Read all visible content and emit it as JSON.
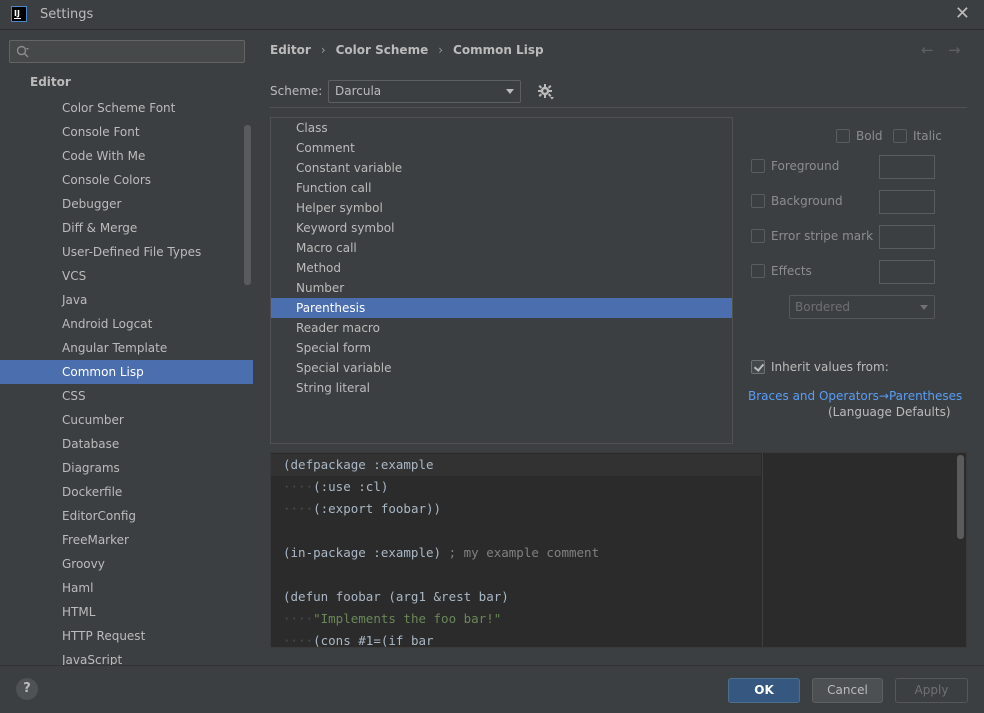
{
  "window": {
    "title": "Settings",
    "app_icon_text": "IJ"
  },
  "sidebar": {
    "search_value": "",
    "header": "Editor",
    "items": [
      "Color Scheme Font",
      "Console Font",
      "Code With Me",
      "Console Colors",
      "Debugger",
      "Diff & Merge",
      "User-Defined File Types",
      "VCS",
      "Java",
      "Android Logcat",
      "Angular Template",
      "Common Lisp",
      "CSS",
      "Cucumber",
      "Database",
      "Diagrams",
      "Dockerfile",
      "EditorConfig",
      "FreeMarker",
      "Groovy",
      "Haml",
      "HTML",
      "HTTP Request",
      "JavaScript"
    ],
    "selected_item": "Common Lisp"
  },
  "breadcrumb": [
    "Editor",
    "Color Scheme",
    "Common Lisp"
  ],
  "scheme": {
    "label": "Scheme:",
    "value": "Darcula"
  },
  "tokens": {
    "items": [
      "Class",
      "Comment",
      "Constant variable",
      "Function call",
      "Helper symbol",
      "Keyword symbol",
      "Macro call",
      "Method",
      "Number",
      "Parenthesis",
      "Reader macro",
      "Special form",
      "Special variable",
      "String literal"
    ],
    "selected": "Parenthesis"
  },
  "options": {
    "bold": "Bold",
    "italic": "Italic",
    "foreground": "Foreground",
    "background": "Background",
    "error_stripe": "Error stripe mark",
    "effects": "Effects",
    "effect_type": "Bordered",
    "inherit_label": "Inherit values from:",
    "inherit_checked": true,
    "inherit_link": "Braces and Operators→Parentheses",
    "inherit_sub": "(Language Defaults)"
  },
  "preview": {
    "lines": [
      {
        "indent": "",
        "code": "(defpackage :example",
        "comment": "",
        "str": "",
        "rest": ""
      },
      {
        "indent": "····",
        "code": "(:use :cl)",
        "comment": "",
        "str": "",
        "rest": ""
      },
      {
        "indent": "····",
        "code": "(:export foobar))",
        "comment": "",
        "str": "",
        "rest": ""
      },
      {
        "indent": "",
        "code": "",
        "comment": "",
        "str": "",
        "rest": ""
      },
      {
        "indent": "",
        "code": "(in-package :example) ",
        "comment": "; my example comment",
        "str": "",
        "rest": ""
      },
      {
        "indent": "",
        "code": "",
        "comment": "",
        "str": "",
        "rest": ""
      },
      {
        "indent": "",
        "code": "(defun foobar (arg1 &rest bar)",
        "comment": "",
        "str": "",
        "rest": ""
      },
      {
        "indent": "····",
        "code": "",
        "comment": "",
        "str": "\"Implements the foo bar!\"",
        "rest": ""
      },
      {
        "indent": "····",
        "code": "(cons #1=(if bar",
        "comment": "",
        "str": "",
        "rest": ""
      }
    ]
  },
  "buttons": {
    "help": "?",
    "ok": "OK",
    "cancel": "Cancel",
    "apply": "Apply"
  },
  "colors": {
    "accent": "#4b6eaf",
    "link": "#589df6",
    "ok_button": "#365880"
  }
}
